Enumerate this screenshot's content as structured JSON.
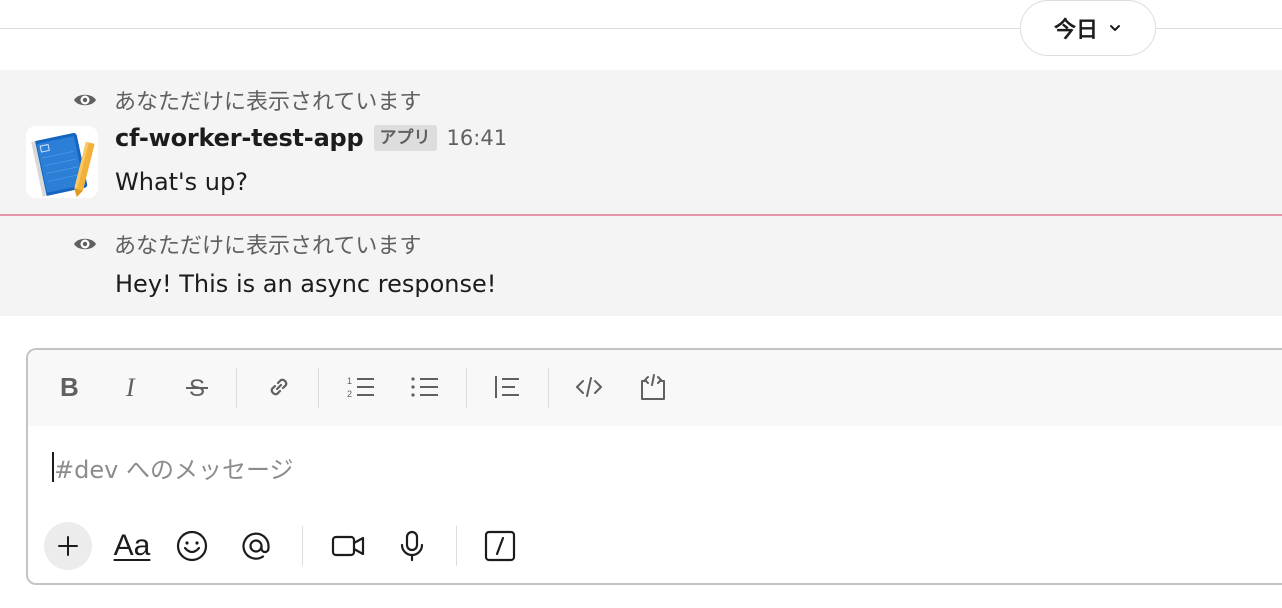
{
  "date_divider": {
    "label": "今日",
    "icon": "chevron-down-icon"
  },
  "messages": [
    {
      "ephemeral_notice": "あなただけに表示されています",
      "sender": "cf-worker-test-app",
      "badge": "アプリ",
      "time": "16:41",
      "text": "What's up?"
    },
    {
      "ephemeral_notice": "あなただけに表示されています",
      "text": "Hey! This is an async response!"
    }
  ],
  "composer": {
    "placeholder": "#dev へのメッセージ",
    "formatting_tools": [
      "bold-icon",
      "italic-icon",
      "strikethrough-icon",
      "link-icon",
      "ordered-list-icon",
      "bulleted-list-icon",
      "blockquote-icon",
      "code-icon",
      "code-block-icon"
    ],
    "action_tools": [
      "plus-icon",
      "text-format-icon",
      "emoji-icon",
      "mention-icon",
      "video-icon",
      "microphone-icon",
      "slash-command-icon"
    ],
    "format_toggle_label": "Aa"
  },
  "colors": {
    "message_bg": "#f4f4f4",
    "new_message_line": "#e497aa",
    "muted_text": "#616061"
  }
}
